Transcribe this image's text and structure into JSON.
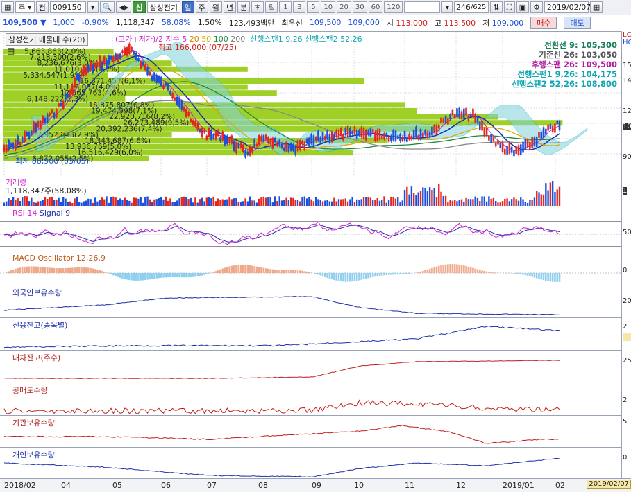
{
  "toolbar": {
    "market": "주",
    "prev": "전",
    "code": "009150",
    "stock_name": "삼성전기",
    "sin": "신",
    "periods": [
      "일",
      "주",
      "월",
      "년",
      "분",
      "초",
      "틱"
    ],
    "minutes": [
      "1",
      "3",
      "5",
      "10",
      "20",
      "30",
      "60",
      "120"
    ],
    "count": "246",
    "total": "/625",
    "date": "2019/02/07"
  },
  "quote": {
    "price": "109,500",
    "change": "1,000",
    "change_pct": "-0.90%",
    "volume": "1,118,347",
    "vol_ratio": "58.08%",
    "turnover": "1.50%",
    "amount": "123,493백만",
    "label_best": "최우선",
    "bid1": "109,500",
    "ask1": "109,000",
    "open_label": "시",
    "open": "113,000",
    "high_label": "고",
    "high": "113,500",
    "low_label": "저",
    "low": "109,000",
    "buy_btn": "매수",
    "sell_btn": "매도"
  },
  "main_panel": {
    "title": "삼성전기 매물대 수(20)",
    "ma_legend": "(고가+저가)/2 지수 5",
    "ma_vals": [
      "20",
      "50",
      "100",
      "200"
    ],
    "ichimoku_legend_a": "선행스팬1 9,26",
    "ichimoku_legend_b": "선행스팬2 52,26",
    "high_label": "최고 166,000 (07/25)",
    "low_label": "최저 88,900 (03/05)",
    "info": [
      {
        "label": "전환선 9: 105,300",
        "color": "#16805a"
      },
      {
        "label": "기준선 26: 103,050",
        "color": "#555555"
      },
      {
        "label": "후행스팬 26: 109,500",
        "color": "#b0199f"
      },
      {
        "label": "선행스팬1 9,26: 104,175",
        "color": "#10a6b0"
      },
      {
        "label": "선행스팬2 52,26: 108,800",
        "color": "#10a6b0"
      }
    ],
    "scale": [
      "15",
      "14",
      "12",
      "10",
      "90"
    ],
    "profile": [
      {
        "text": "5,663,863(2,0%)",
        "len": 0.19
      },
      {
        "text": "7,218,300(2,6%)",
        "len": 0.23
      },
      {
        "text": "8,236,676(3,0%)",
        "len": 0.29
      },
      {
        "text": "11,010,325(4,7%)",
        "len": 0.42
      },
      {
        "text": "5,334,547(1,9%)",
        "len": 0.18
      },
      {
        "text": "16,371,457(6,1%)",
        "len": 0.62
      },
      {
        "text": "11,116,057(4,0%)",
        "len": 0.42
      },
      {
        "text": "12,665,763(4,6%)",
        "len": 0.47
      },
      {
        "text": "6,148,222(2,3%)",
        "len": 0.21
      },
      {
        "text": "18,875,807(6,8%)",
        "len": 0.69
      },
      {
        "text": "19,474,998(7,1%)",
        "len": 0.71
      },
      {
        "text": "22,920,716(8,2%)",
        "len": 0.85
      },
      {
        "text": "26,273,489(9,5%)",
        "len": 0.96
      },
      {
        "text": "20,392,236(7,4%)",
        "len": 0.75
      },
      {
        "text": "7,952,843(2,9%)",
        "len": 0.29
      },
      {
        "text": "18,343,687(6,6%)",
        "len": 0.66
      },
      {
        "text": "13,936,769(5,0%)",
        "len": 0.51
      },
      {
        "text": "16,516,429(6,0%)",
        "len": 0.6
      },
      {
        "text": "6,872,055(2,5%)",
        "len": 0.25
      }
    ]
  },
  "volume_panel": {
    "title": "거래량",
    "value": "1,118,347주(58,08%)",
    "scale": "1"
  },
  "rsi_panel": {
    "title_a": "RSI 14",
    "title_b": "Signal 9",
    "scale": "50"
  },
  "macd_panel": {
    "title": "MACD Oscillator 12,26,9",
    "scale": "0"
  },
  "foreign_panel": {
    "title": "외국인보유수량",
    "scale": "20"
  },
  "credit_panel": {
    "title": "신용잔고(종목별)",
    "scale": "2"
  },
  "lending_panel": {
    "title": "대차잔고(주수)",
    "scale": "25"
  },
  "short_panel": {
    "title": "공매도수량",
    "scale": "2"
  },
  "inst_panel": {
    "title": "기관보유수량",
    "scale": "5"
  },
  "indiv_panel": {
    "title": "개인보유수량",
    "scale": "0"
  },
  "xaxis": {
    "labels": [
      "2018/02",
      "04",
      "05",
      "06",
      "07",
      "08",
      "09",
      "10",
      "11",
      "12",
      "2019/01",
      "02"
    ],
    "end_date": "2019/02/07"
  }
}
